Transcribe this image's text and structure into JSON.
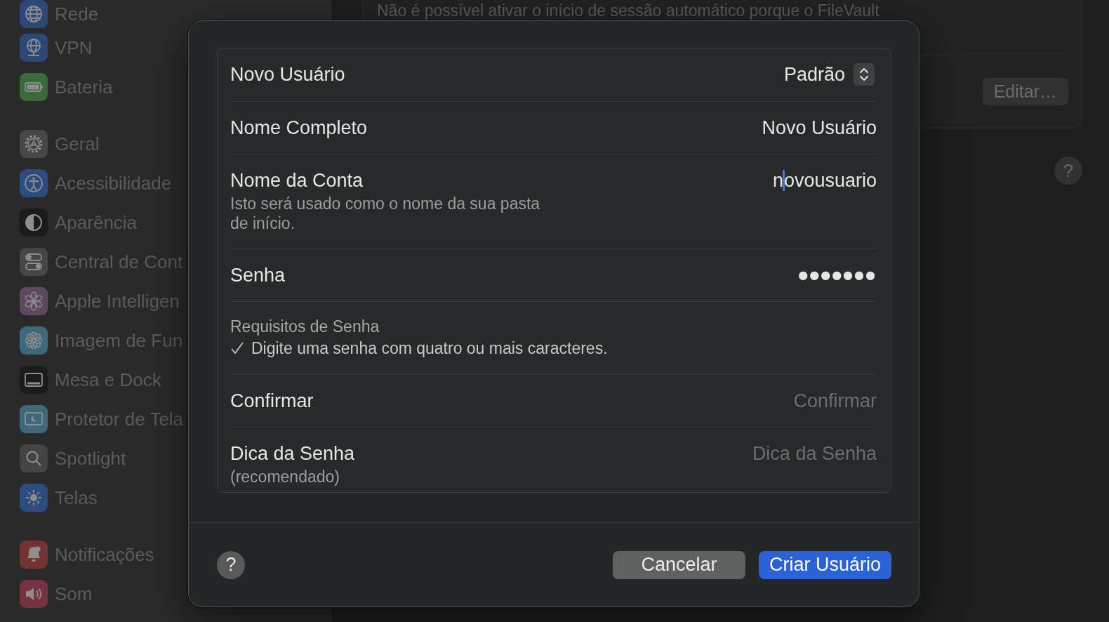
{
  "sidebar": {
    "groups": [
      {
        "items": [
          {
            "label": "Rede",
            "color": "#2c4877",
            "selected": false
          },
          {
            "label": "VPN",
            "color": "#2c4877",
            "selected": false
          },
          {
            "label": "Bateria",
            "color": "#386a3a",
            "selected": false
          }
        ]
      },
      {
        "items": [
          {
            "label": "Geral",
            "color": "#474747",
            "selected": false
          },
          {
            "label": "Acessibilidade",
            "color": "#2d4c80",
            "selected": false
          },
          {
            "label": "Aparência",
            "color": "#1b1b1b",
            "selected": false
          },
          {
            "label": "Central de Cont",
            "color": "#474747",
            "selected": false
          },
          {
            "label": "Apple Intelligen",
            "color": "#5e4a5e",
            "selected": false
          },
          {
            "label": "Imagem de Fun",
            "color": "#3d697a",
            "selected": false
          },
          {
            "label": "Mesa e Dock",
            "color": "#1b1b1b",
            "selected": false
          },
          {
            "label": "Protetor de Tela",
            "color": "#3d697a",
            "selected": false
          },
          {
            "label": "Spotlight",
            "color": "#444444",
            "selected": false
          },
          {
            "label": "Telas",
            "color": "#2d4c80",
            "selected": false
          }
        ]
      },
      {
        "items": [
          {
            "label": "Notificações",
            "color": "#763333",
            "selected": false
          },
          {
            "label": "Som",
            "color": "#76333f",
            "selected": false
          }
        ]
      }
    ]
  },
  "settings_panel": {
    "notice": "Não é possível ativar o início de sessão automático porque o FileVault",
    "edit_button": "Editar…",
    "help_button": "?"
  },
  "dialog": {
    "rows": [
      {
        "kind": "popup",
        "label": "Novo Usuário",
        "value": "Padrão"
      },
      {
        "kind": "text",
        "label": "Nome Completo",
        "value": "Novo Usuário"
      },
      {
        "kind": "text",
        "label": "Nome da Conta",
        "note": "Isto será usado como o nome da sua pasta de início.",
        "value_before_caret": "n",
        "value_after_caret": "ovousuario"
      },
      {
        "kind": "password",
        "label": "Senha",
        "value": "●●●●●●●"
      },
      {
        "kind": "requirements",
        "title": "Requisitos de Senha",
        "items": [
          {
            "text": "Digite uma senha com quatro ou mais caracteres.",
            "met": true
          }
        ]
      },
      {
        "kind": "text",
        "label": "Confirmar",
        "placeholder": "Confirmar"
      },
      {
        "kind": "text",
        "label": "Dica da Senha",
        "note": "(recomendado)",
        "placeholder": "Dica da Senha"
      }
    ],
    "help_button": "?",
    "buttons": [
      {
        "label": "Cancelar",
        "kind": "secondary"
      },
      {
        "label": "Criar Usuário",
        "kind": "primary"
      }
    ]
  }
}
